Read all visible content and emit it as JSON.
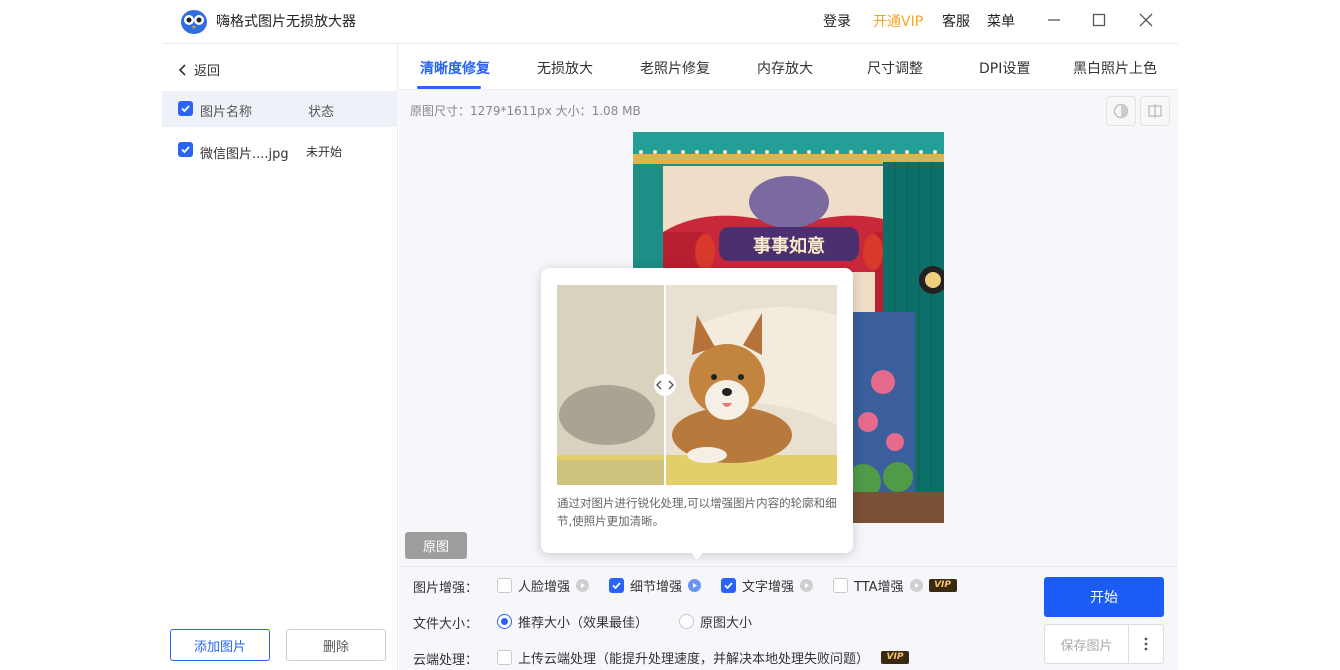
{
  "app": {
    "title": "嗨格式图片无损放大器",
    "login": "登录",
    "vip": "开通VIP",
    "service": "客服",
    "menu": "菜单"
  },
  "left": {
    "back": "返回",
    "header_name": "图片名称",
    "header_status": "状态",
    "files": [
      {
        "name": "微信图片....jpg",
        "status": "未开始"
      }
    ],
    "add_button": "添加图片",
    "delete_button": "删除"
  },
  "tabs": [
    {
      "label": "清晰度修复"
    },
    {
      "label": "无损放大"
    },
    {
      "label": "老照片修复"
    },
    {
      "label": "内存放大"
    },
    {
      "label": "尺寸调整"
    },
    {
      "label": "DPI设置"
    },
    {
      "label": "黑白照片上色"
    }
  ],
  "meta": "原图尺寸：1279*1611px   大小：1.08 MB",
  "preview": {
    "original_button": "原图",
    "banner_text": "事事如意"
  },
  "popup": {
    "description": "通过对图片进行锐化处理,可以增强图片内容的轮廓和细节,使照片更加清晰。"
  },
  "options": {
    "enhance_label": "图片增强：",
    "face": "人脸增强",
    "detail": "细节增强",
    "text": "文字增强",
    "tta": "TTA增强",
    "vip_badge": "VIP",
    "size_label": "文件大小：",
    "size_recommended": "推荐大小（效果最佳）",
    "size_original": "原图大小",
    "cloud_label": "云端处理：",
    "cloud_upload": "上传云端处理（能提升处理速度，并解决本地处理失败问题）"
  },
  "actions": {
    "start": "开始",
    "save": "保存图片"
  },
  "colors": {
    "accent": "#2a64f6",
    "vip": "#f5a623"
  }
}
